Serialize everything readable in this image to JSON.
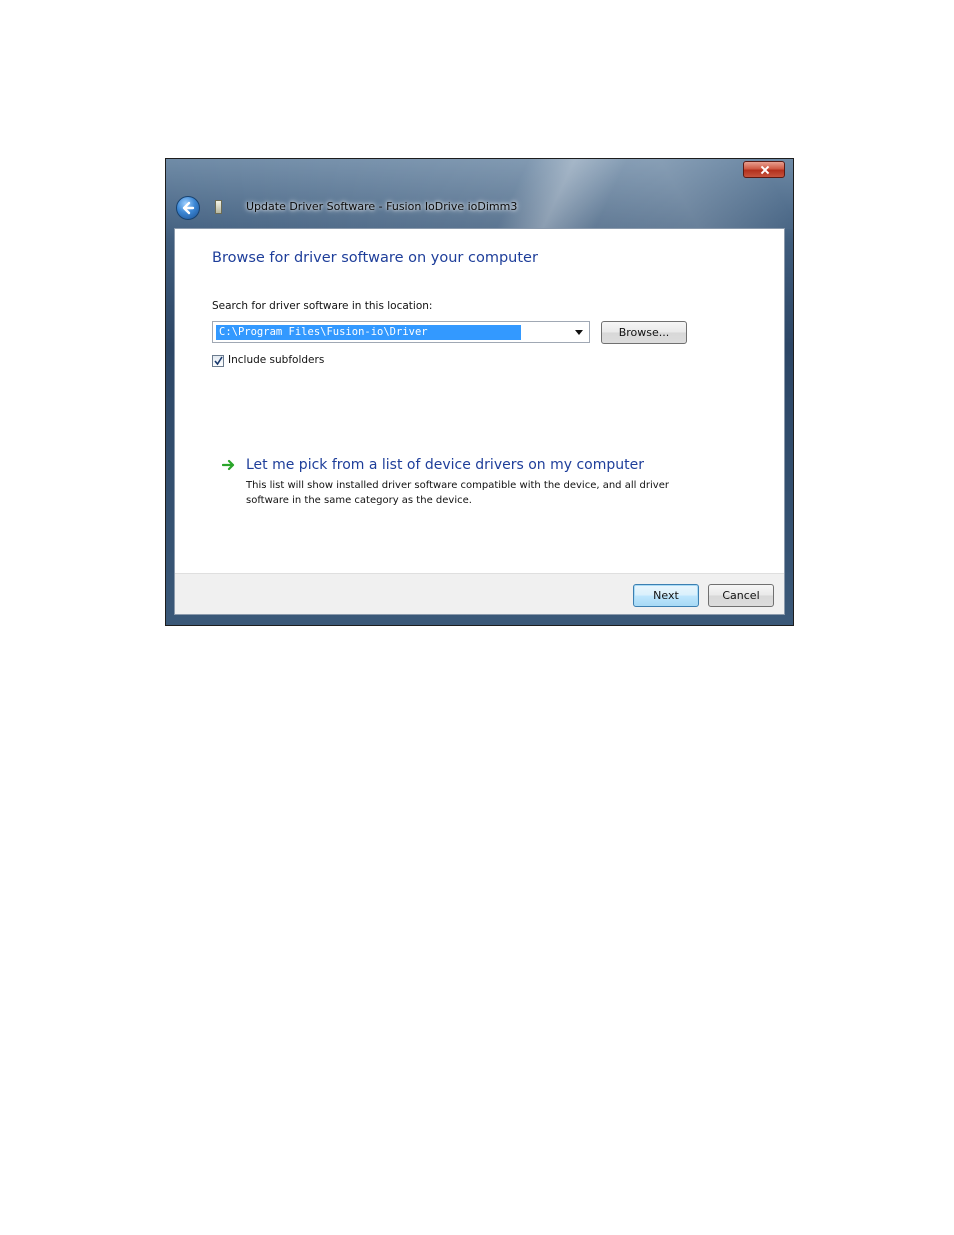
{
  "window": {
    "title": "Update Driver Software - Fusion IoDrive ioDimm3",
    "close_icon": "close-x-icon",
    "back_icon": "back-arrow-icon"
  },
  "content": {
    "heading": "Browse for driver software on your computer",
    "search_label": "Search for driver software in this location:",
    "path_value": "C:\\Program Files\\Fusion-io\\Driver",
    "browse_label": "Browse...",
    "include_subfolders_label": "Include subfolders",
    "include_subfolders_checked": true,
    "pick_title": "Let me pick from a list of device drivers on my computer",
    "pick_description": "This list will show installed driver software compatible with the device, and all driver software in the same category as the device.",
    "pick_icon": "green-arrow-icon"
  },
  "footer": {
    "next_label": "Next",
    "cancel_label": "Cancel"
  },
  "colors": {
    "heading_blue": "#1e3e9a",
    "selection_blue": "#3399ff",
    "arrow_green": "#2aa52a",
    "close_red": "#c6533d"
  }
}
